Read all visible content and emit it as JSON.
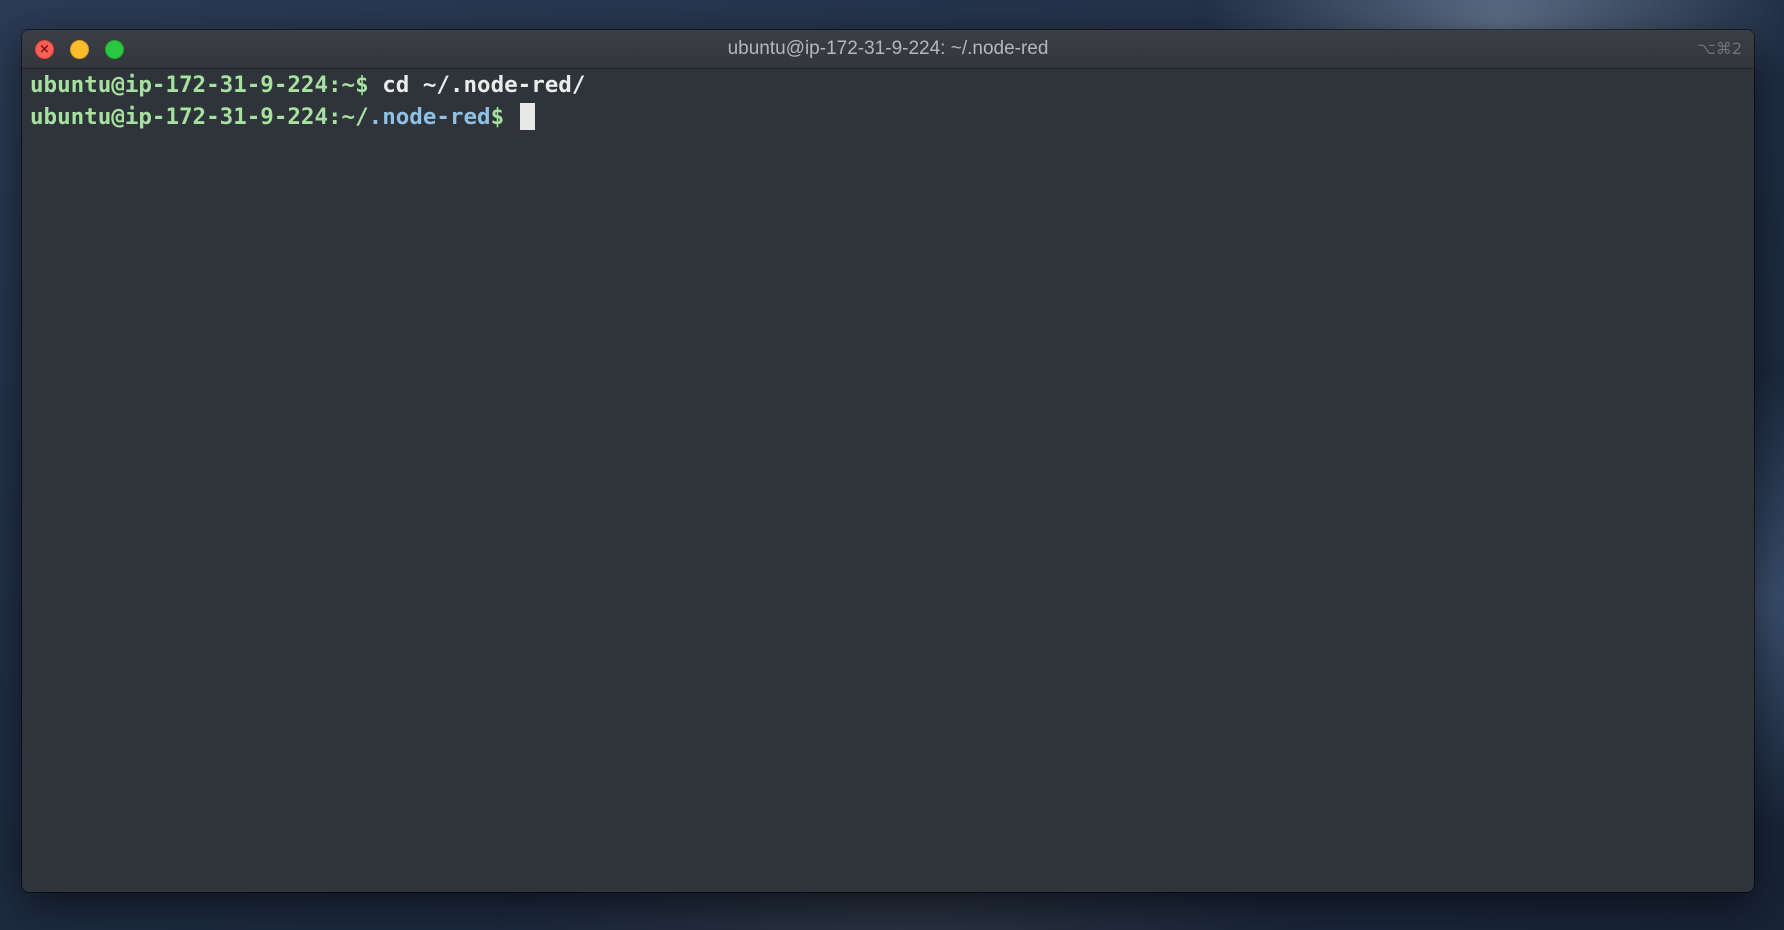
{
  "window": {
    "title": "ubuntu@ip-172-31-9-224: ~/.node-red",
    "shortcut": "⌥⌘2",
    "buttons": {
      "close_glyph": "×"
    }
  },
  "terminal": {
    "lines": [
      {
        "prompt": "ubuntu@ip-172-31-9-224:~$",
        "command": " cd ~/.node-red/"
      },
      {
        "prompt_prefix": "ubuntu@ip-172-31-9-224:~/",
        "prompt_dir": ".node-red",
        "prompt_suffix": "$",
        "command": " "
      }
    ]
  },
  "colors": {
    "terminal_bg": "#2e3439",
    "prompt": "#a6e1a0",
    "directory": "#8fc0e6",
    "text": "#ececec"
  }
}
